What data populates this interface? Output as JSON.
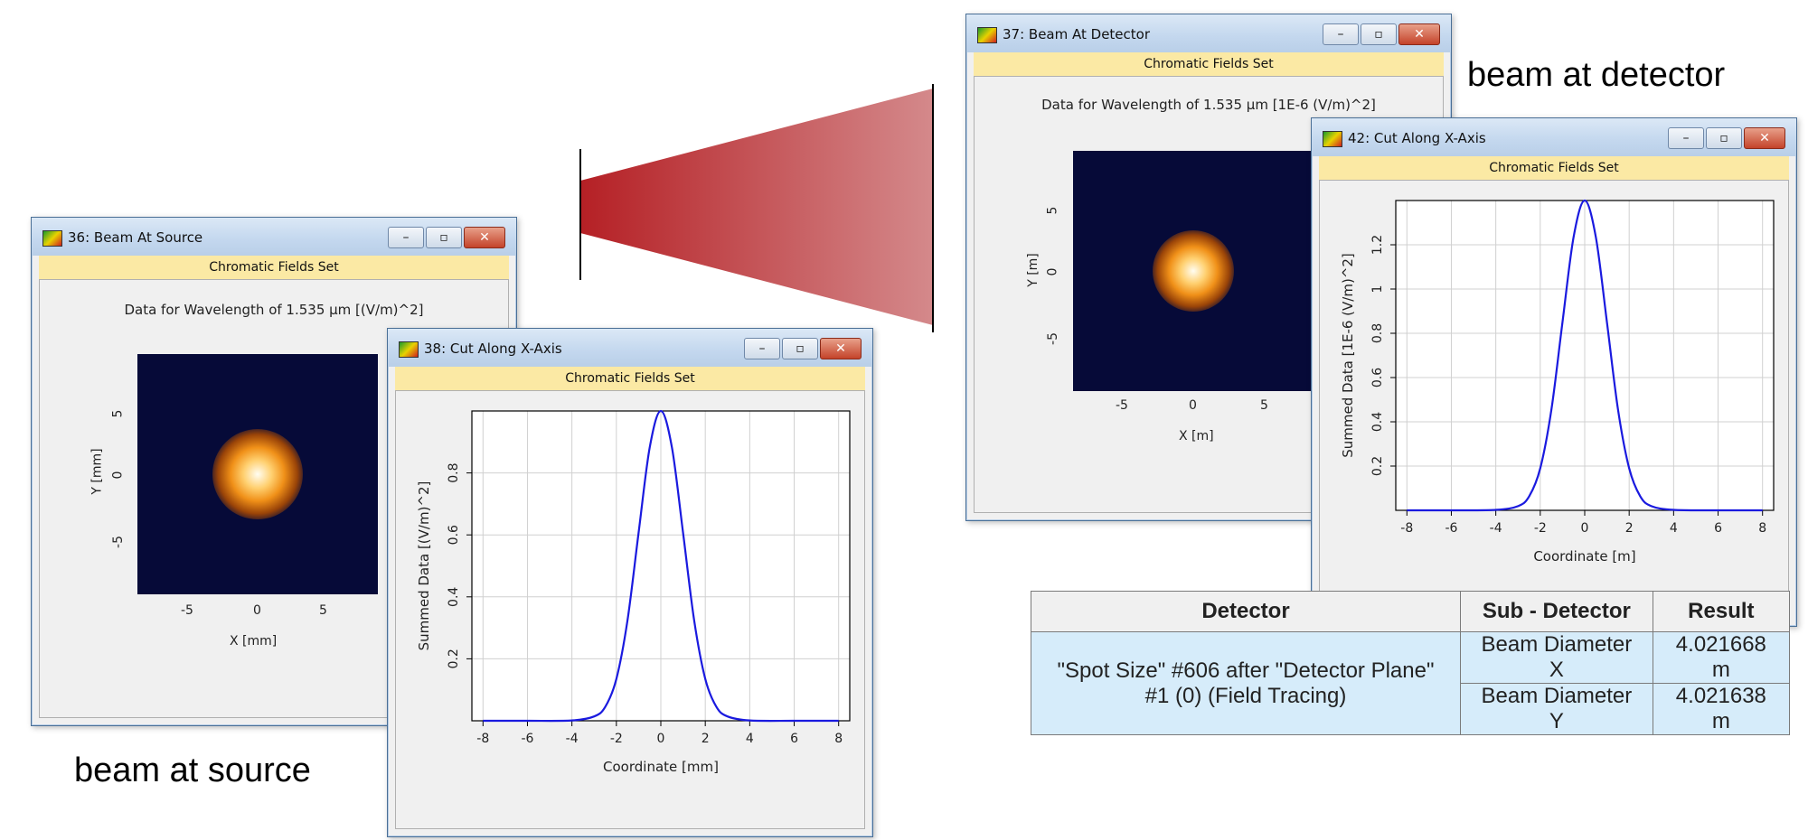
{
  "captions": {
    "source": "beam at source",
    "detector": "beam at detector"
  },
  "windows": {
    "w36": {
      "title": "36: Beam At Source",
      "band": "Chromatic Fields Set",
      "data_label": "Data for Wavelength of 1.535 µm  [(V/m)^2]",
      "xlabel": "X [mm]",
      "ylabel": "Y [mm]",
      "xticks": [
        "-5",
        "0",
        "5"
      ],
      "yticks": [
        "5",
        "0",
        "-5"
      ]
    },
    "w38": {
      "title": "38: Cut Along X-Axis",
      "band": "Chromatic Fields Set"
    },
    "w37": {
      "title": "37: Beam At Detector",
      "band": "Chromatic Fields Set",
      "data_label": "Data for Wavelength of 1.535 µm  [1E-6 (V/m)^2]",
      "xlabel": "X [m]",
      "ylabel": "Y [m]",
      "xticks": [
        "-5",
        "0",
        "5"
      ],
      "yticks": [
        "5",
        "0",
        "-5"
      ]
    },
    "w42": {
      "title": "42: Cut Along X-Axis",
      "band": "Chromatic Fields Set"
    },
    "controls": {
      "minimize": "–",
      "maximize": "▫",
      "close": "✕"
    }
  },
  "colors": {
    "beam_dark": "#b52025",
    "beam_light": "#d4898b",
    "map_bg": "#060a38",
    "curve": "#1a1adf",
    "title_band": "#fbe9a4",
    "table_cell": "#d6ecfa"
  },
  "chart_data": [
    {
      "type": "line",
      "xlabel": "Coordinate [mm]",
      "ylabel": "Summed Data [(V/m)^2]",
      "xlim": [
        -8.5,
        8.5
      ],
      "ylim": [
        0,
        1.0
      ],
      "xticks": [
        -8,
        -6,
        -4,
        -2,
        0,
        2,
        4,
        6,
        8
      ],
      "yticks": [
        0.2,
        0.4,
        0.6,
        0.8
      ],
      "x": [
        -8,
        -6,
        -4,
        -3,
        -2.5,
        -2,
        -1.5,
        -1,
        -0.5,
        0,
        0.5,
        1,
        1.5,
        2,
        2.5,
        3,
        4,
        6,
        8
      ],
      "series": [
        {
          "values": [
            0,
            0,
            0.001,
            0.014,
            0.045,
            0.135,
            0.324,
            0.607,
            0.882,
            1.0,
            0.882,
            0.607,
            0.324,
            0.135,
            0.045,
            0.014,
            0.001,
            0,
            0
          ]
        }
      ],
      "grid": true
    },
    {
      "type": "line",
      "xlabel": "Coordinate [m]",
      "ylabel": "Summed Data [1E-6 (V/m)^2]",
      "xlim": [
        -8.5,
        8.5
      ],
      "ylim": [
        0,
        1.4
      ],
      "xticks": [
        -8,
        -6,
        -4,
        -2,
        0,
        2,
        4,
        6,
        8
      ],
      "yticks": [
        0.2,
        0.4,
        0.6,
        0.8,
        1,
        1.2
      ],
      "x": [
        -8,
        -6,
        -4,
        -3,
        -2.5,
        -2,
        -1.5,
        -1,
        -0.5,
        0,
        0.5,
        1,
        1.5,
        2,
        2.5,
        3,
        4,
        6,
        8
      ],
      "series": [
        {
          "values": [
            0,
            0,
            0.002,
            0.019,
            0.063,
            0.19,
            0.454,
            0.85,
            1.235,
            1.4,
            1.235,
            0.85,
            0.454,
            0.19,
            0.063,
            0.019,
            0.002,
            0,
            0
          ]
        }
      ],
      "grid": true
    }
  ],
  "result_table": {
    "headers": [
      "Detector",
      "Sub - Detector",
      "Result"
    ],
    "detector_line1": "\"Spot Size\" #606 after \"Detector Plane\"",
    "detector_line2": "#1 (0) (Field Tracing)",
    "rows": [
      {
        "sub": "Beam Diameter X",
        "result": "4.021668 m"
      },
      {
        "sub": "Beam Diameter Y",
        "result": "4.021638 m"
      }
    ]
  }
}
